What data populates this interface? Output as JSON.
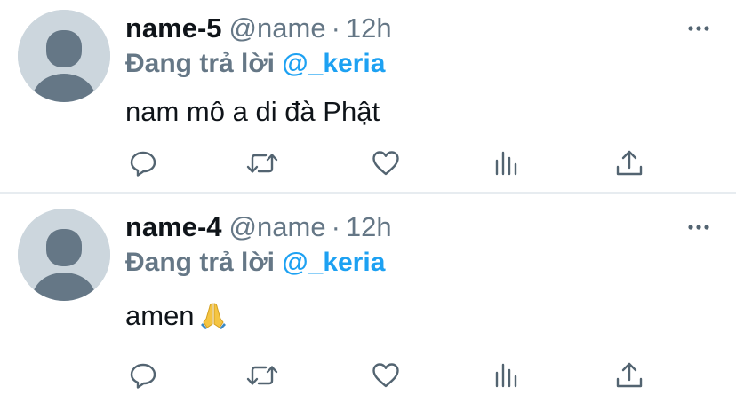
{
  "tweets": [
    {
      "name": "name-5",
      "handle": "@name",
      "separator": "·",
      "time": "12h",
      "replying_label": "Đang trả lời",
      "replying_to": "@_keria",
      "text": "nam mô a di đà Phật",
      "emoji": ""
    },
    {
      "name": "name-4",
      "handle": "@name",
      "separator": "·",
      "time": "12h",
      "replying_label": "Đang trả lời",
      "replying_to": "@_keria",
      "text": "amen",
      "emoji": "folded-hands-emoji"
    }
  ],
  "icons": {
    "more": "more-horizontal-icon",
    "reply": "reply-icon",
    "retweet": "retweet-icon",
    "like": "heart-icon",
    "stats": "stats-icon",
    "share": "share-icon",
    "avatar": "default-avatar-icon"
  },
  "colors": {
    "name": "#0f1419",
    "secondary_text": "#657786",
    "mention_link": "#1da1f2",
    "icon": "#536471",
    "avatar_bg": "#ccd6dd",
    "avatar_figure": "#657786",
    "divider": "#e7ecf0"
  }
}
